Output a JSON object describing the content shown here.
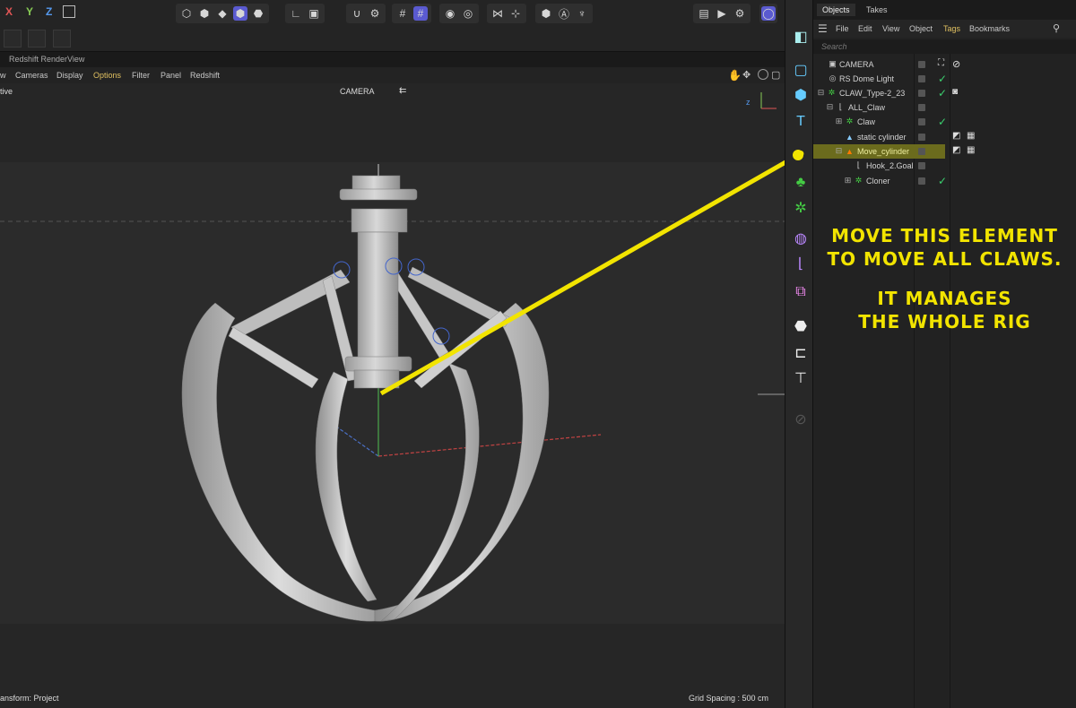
{
  "toolbar": {
    "axis_x": "X",
    "axis_y": "Y",
    "axis_z": "Z",
    "axis_colors": {
      "x": "#e05555",
      "y": "#88cc55",
      "z": "#5599ee"
    }
  },
  "renderview": {
    "title": "Redshift RenderView"
  },
  "viewport_menu": {
    "view": "w",
    "cameras": "Cameras",
    "display": "Display",
    "options": "Options",
    "filter": "Filter",
    "panel": "Panel",
    "redshift": "Redshift"
  },
  "viewport": {
    "mode_label": "tive",
    "camera_label": "CAMERA",
    "transform_status": "ansform: Project",
    "grid_spacing": "Grid Spacing : 500 cm",
    "axis_gizmo": "z"
  },
  "object_manager": {
    "tabs": [
      "Objects",
      "Takes"
    ],
    "menu": {
      "file": "File",
      "edit": "Edit",
      "view": "View",
      "object": "Object",
      "tags": "Tags",
      "bookmarks": "Bookmarks"
    },
    "search_placeholder": "Search",
    "objects": [
      {
        "name": "CAMERA",
        "icon": "camera-icon"
      },
      {
        "name": "RS Dome Light",
        "icon": "light-icon"
      },
      {
        "name": "CLAW_Type-2_23",
        "icon": "null-icon"
      },
      {
        "name": "ALL_Claw",
        "icon": "null-icon"
      },
      {
        "name": "Claw",
        "icon": "cloner-icon"
      },
      {
        "name": "static cylinder",
        "icon": "polygon-icon"
      },
      {
        "name": "Move_cylinder",
        "icon": "polygon-icon"
      },
      {
        "name": "Hook_2.Goal",
        "icon": "null-icon"
      },
      {
        "name": "Cloner",
        "icon": "cloner-icon"
      }
    ]
  },
  "callout": {
    "line1": "MOVE THIS ELEMENT",
    "line2": "TO MOVE ALL CLAWS.",
    "line3": "IT MANAGES",
    "line4": "THE WHOLE RIG",
    "color": "#f2e400"
  },
  "colors": {
    "accent": "#5a5ad0",
    "selection": "#6b6b1d",
    "check": "#3bd16f"
  }
}
